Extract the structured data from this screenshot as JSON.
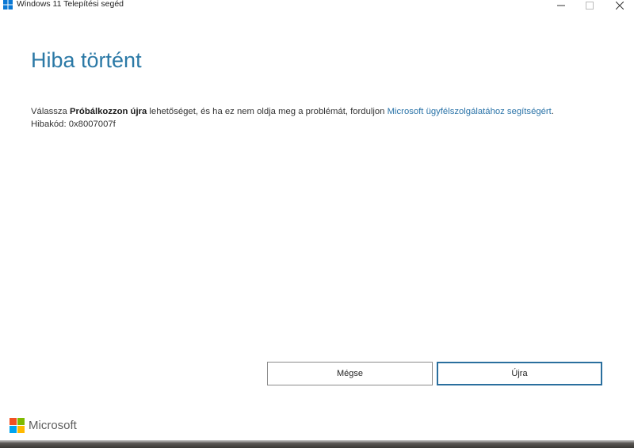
{
  "window": {
    "title": "Windows 11 Telepítési segéd",
    "controls": {
      "minimize": "–",
      "maximize": "☐",
      "close": "✕"
    }
  },
  "content": {
    "heading": "Hiba történt",
    "message_prefix": "Válassza ",
    "message_bold": "Próbálkozzon újra",
    "message_middle": " lehetőséget, és ha ez nem oldja meg a problémát, forduljon ",
    "message_link": "Microsoft ügyfélszolgálatához segítségért",
    "message_suffix": ".",
    "error_code": "Hibakód: 0x8007007f"
  },
  "buttons": {
    "cancel": "Mégse",
    "retry": "Újra"
  },
  "footer": {
    "brand": "Microsoft"
  },
  "colors": {
    "heading": "#2b79a6",
    "link": "#2a73a8",
    "primary_border": "#2a6f9e",
    "ms_red": "#f25022",
    "ms_green": "#7fba00",
    "ms_blue": "#00a4ef",
    "ms_yellow": "#ffb900"
  }
}
